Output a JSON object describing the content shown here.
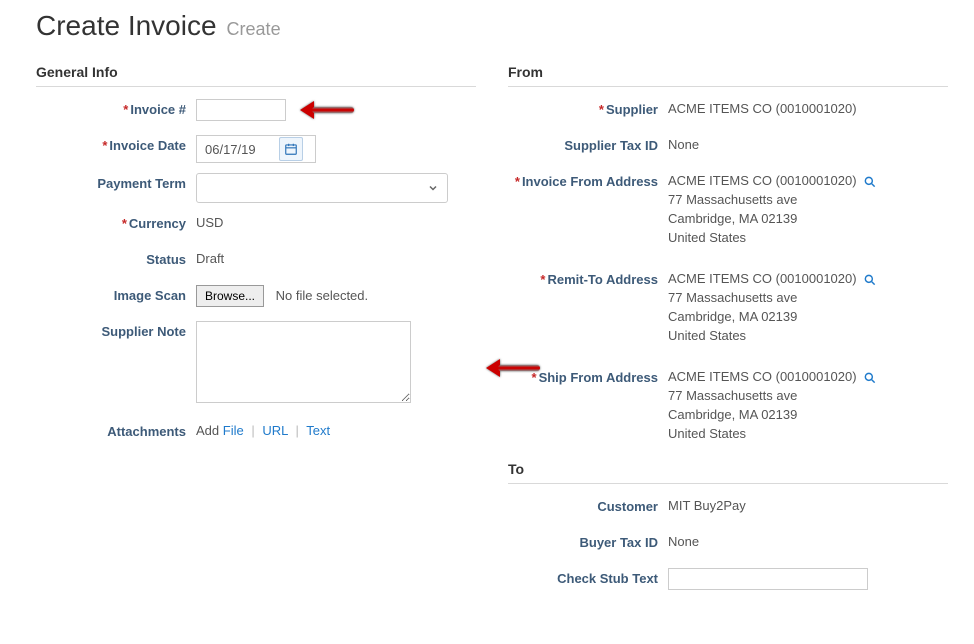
{
  "page": {
    "title": "Create Invoice",
    "subtitle": "Create"
  },
  "sections": {
    "general": "General Info",
    "from": "From",
    "to": "To"
  },
  "general": {
    "invoice_num_label": "Invoice #",
    "invoice_num_value": "",
    "invoice_date_label": "Invoice Date",
    "invoice_date_value": "06/17/19",
    "payment_term_label": "Payment Term",
    "payment_term_value": "",
    "currency_label": "Currency",
    "currency_value": "USD",
    "status_label": "Status",
    "status_value": "Draft",
    "image_scan_label": "Image Scan",
    "browse_label": "Browse...",
    "no_file_text": "No file selected.",
    "supplier_note_label": "Supplier Note",
    "supplier_note_value": "",
    "attachments_label": "Attachments",
    "attach_add": "Add",
    "attach_file": "File",
    "attach_url": "URL",
    "attach_text": "Text"
  },
  "from": {
    "supplier_label": "Supplier",
    "supplier_value": "ACME ITEMS CO (0010001020)",
    "supplier_tax_label": "Supplier Tax ID",
    "supplier_tax_value": "None",
    "invoice_from_label": "Invoice From Address",
    "remit_to_label": "Remit-To Address",
    "ship_from_label": "Ship From Address",
    "addr_name": "ACME ITEMS CO (0010001020)",
    "addr_l1": "77 Massachusetts ave",
    "addr_l2": "Cambridge, MA 02139",
    "addr_l3": "United States"
  },
  "to": {
    "customer_label": "Customer",
    "customer_value": "MIT Buy2Pay",
    "buyer_tax_label": "Buyer Tax ID",
    "buyer_tax_value": "None",
    "check_stub_label": "Check Stub Text",
    "check_stub_value": ""
  }
}
